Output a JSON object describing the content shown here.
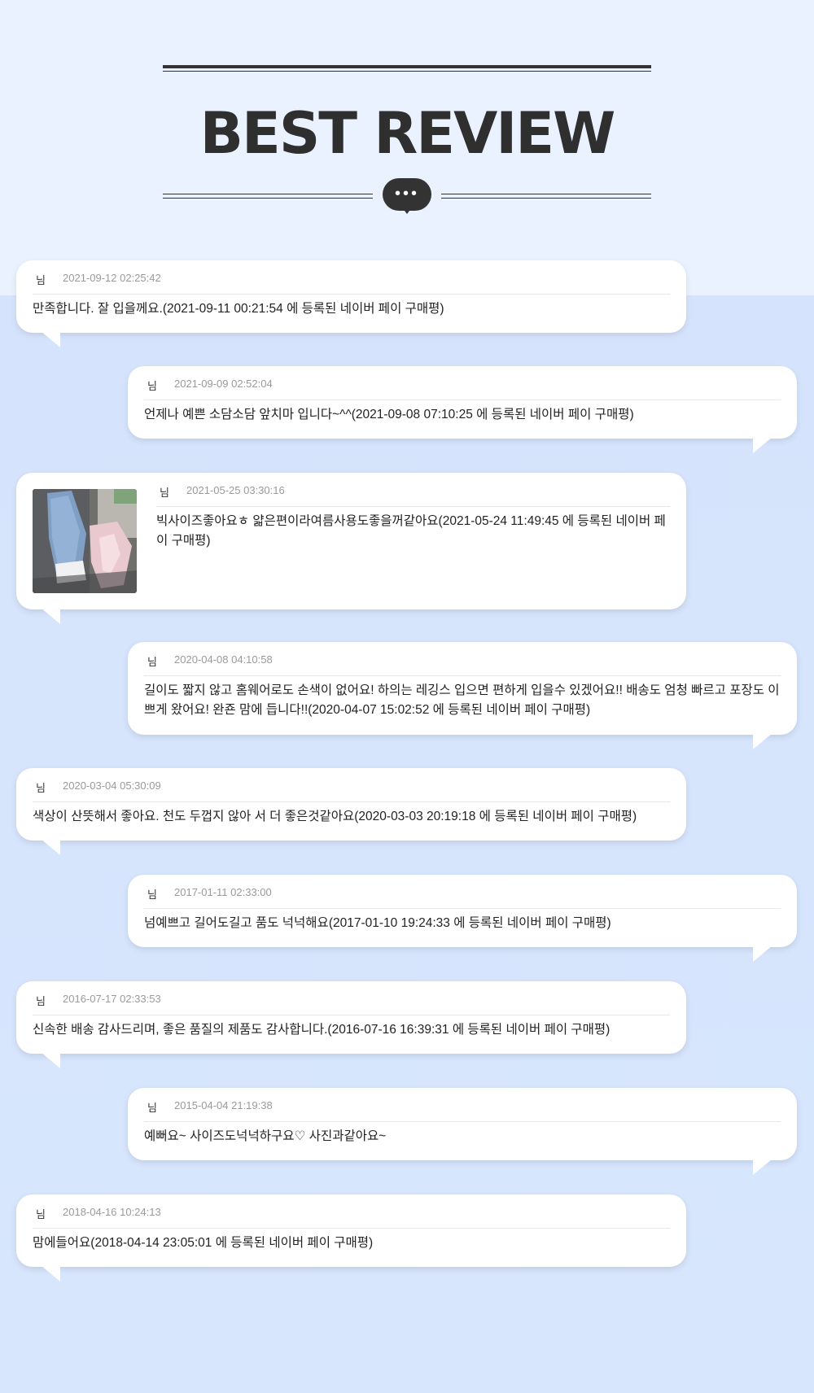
{
  "header": {
    "title": "BEST REVIEW",
    "chat_icon": "ellipsis-speech-bubble"
  },
  "reviews": [
    {
      "nickname": "님",
      "date": "2021-09-12 02:25:42",
      "content": "만족합니다. 잘 입을께요.(2021-09-11 00:21:54 에 등록된 네이버 페이 구매평)"
    },
    {
      "nickname": "님",
      "date": "2021-09-09 02:52:04",
      "content": "언제나 예쁜 소담소담 앞치마 입니다~^^(2021-09-08 07:10:25 에 등록된 네이버 페이 구매평)"
    },
    {
      "nickname": "님",
      "date": "2021-05-25 03:30:16",
      "content": "빅사이즈좋아요ㅎ 얇은편이라여름사용도좋을꺼같아요(2021-05-24 11:49:45 에 등록된 네이버 페이 구매평)",
      "photo": "photo of blue and pink ruffled garments"
    },
    {
      "nickname": "님",
      "date": "2020-04-08 04:10:58",
      "content": "길이도 짧지 않고 홈웨어로도 손색이 없어요! 하의는 레깅스 입으면 편하게 입을수 있겠어요!! 배송도 엄청 빠르고 포장도 이쁘게 왔어요! 완죤 맘에 듭니다!!(2020-04-07 15:02:52 에 등록된 네이버 페이 구매평)"
    },
    {
      "nickname": "님",
      "date": "2020-03-04 05:30:09",
      "content": "색상이 산뜻해서 좋아요. 천도 두껍지 않아 서 더 좋은것같아요(2020-03-03 20:19:18 에 등록된 네이버 페이 구매평)"
    },
    {
      "nickname": "님",
      "date": "2017-01-11 02:33:00",
      "content": "넘예쁘고 길어도길고 품도 넉넉해요(2017-01-10 19:24:33 에 등록된 네이버 페이 구매평)"
    },
    {
      "nickname": "님",
      "date": "2016-07-17 02:33:53",
      "content": "신속한 배송 감사드리며, 좋은 품질의 제품도 감사합니다.(2016-07-16 16:39:31 에 등록된 네이버 페이 구매평)"
    },
    {
      "nickname": "님",
      "date": "2015-04-04 21:19:38",
      "content": "예뻐요~ 사이즈도넉넉하구요♡ 사진과같아요~"
    },
    {
      "nickname": "님",
      "date": "2018-04-16 10:24:13",
      "content": "맘에들어요(2018-04-14 23:05:01 에 등록된 네이버 페이 구매평)"
    }
  ]
}
